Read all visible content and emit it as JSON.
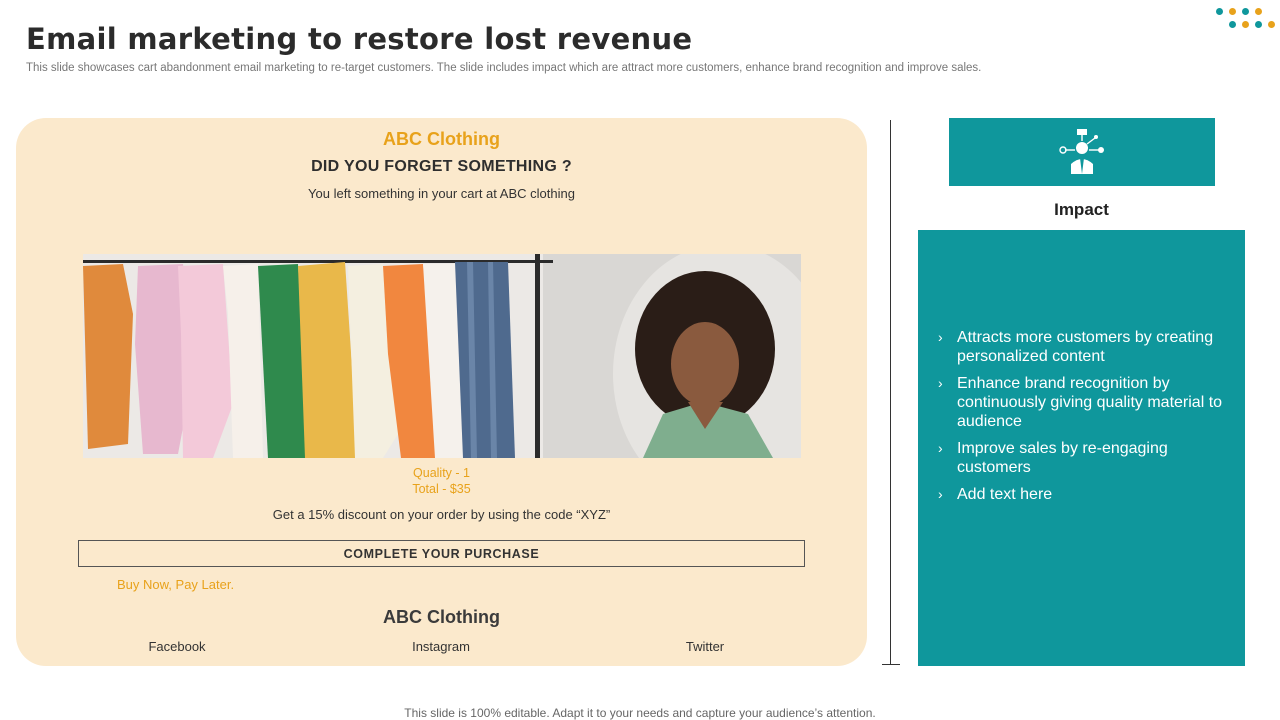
{
  "header": {
    "title": "Email marketing to restore lost revenue",
    "subtitle": "This slide showcases cart abandonment email marketing to re-target customers. The slide includes impact which are attract more customers, enhance brand recognition and improve sales."
  },
  "email": {
    "brand": "ABC Clothing",
    "headline": "DID YOU FORGET SOMETHING ?",
    "subline": "You left something in your cart at ABC clothing",
    "quantity": "Quality - 1",
    "total": "Total - $35",
    "discount": "Get a 15% discount on your order by using the  code “XYZ”",
    "cta_label": "COMPLETE YOUR PURCHASE",
    "bnpl": "Buy Now, Pay Later.",
    "footer_brand": "ABC Clothing",
    "social": {
      "facebook": "Facebook",
      "instagram": "Instagram",
      "twitter": "Twitter"
    }
  },
  "impact": {
    "title": "Impact",
    "icon": "customer-network-icon",
    "items": [
      "Attracts more customers by creating personalized content",
      "Enhance brand recognition by continuously  giving quality material to audience",
      "Improve sales by re-engaging customers",
      "Add text here"
    ]
  },
  "footer": {
    "note": "This slide is 100% editable. Adapt it to your needs and capture your audience’s attention."
  },
  "colors": {
    "accent_orange": "#e8a21b",
    "teal": "#0f979c",
    "card_bg": "#fbe9cc"
  }
}
